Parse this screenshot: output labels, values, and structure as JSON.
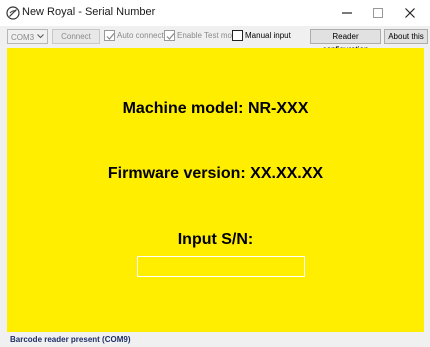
{
  "window": {
    "title": "New Royal - Serial Number",
    "controls": [
      "minimize-icon",
      "maximize-icon",
      "close-icon"
    ]
  },
  "toolbar": {
    "port_select_value": "COM3",
    "connect_label": "Connect",
    "auto_connect_label": "Auto connect",
    "auto_connect_checked": true,
    "test_mode_label": "Enable Test mode",
    "test_mode_checked": true,
    "manual_input_label": "Manual input",
    "manual_input_checked": false,
    "reader_config_label": "Reader configuration",
    "about_label": "About this"
  },
  "main": {
    "machine_model_text": "Machine model: NR-XXX",
    "firmware_text": "Firmware version: XX.XX.XX",
    "input_label": "Input S/N:",
    "serial_input_value": "",
    "background_color": "#ffee00"
  },
  "status_bar": {
    "text": "Barcode reader present (COM9)"
  }
}
